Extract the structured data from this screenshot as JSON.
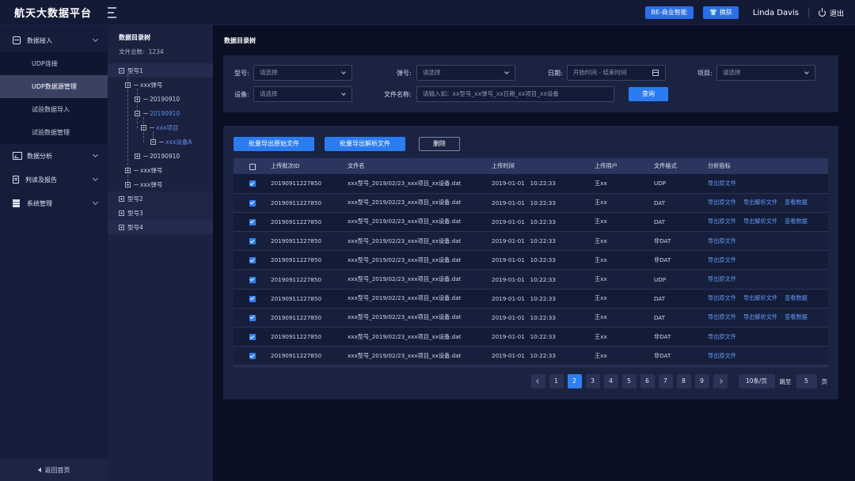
{
  "app": {
    "title": "航天大数据平台"
  },
  "topbar": {
    "btn_be": "BE-商业智能",
    "btn_skin": "换肤",
    "user": "Linda Davis",
    "logout": "退出"
  },
  "sidebar": {
    "groups": [
      {
        "label": "数据接入",
        "icon": "database-icon"
      },
      {
        "label": "数据分析",
        "icon": "chart-icon"
      },
      {
        "label": "判读及报告",
        "icon": "document-icon"
      },
      {
        "label": "系统管理",
        "icon": "stack-icon"
      }
    ],
    "subs": [
      "UDP连接",
      "UDP数据源管理",
      "试验数据导入",
      "试验数据管理"
    ],
    "back_home": "返回首页"
  },
  "tree": {
    "title": "数据目录树",
    "count_label": "文件总数:",
    "count": "1234",
    "nodes": [
      "型号1",
      "xxx弹号",
      "20190910",
      "20190910",
      "xxx项目",
      "xxx设备A",
      "20190910",
      "xxx弹号",
      "xxx弹号",
      "型号2",
      "型号3",
      "型号4"
    ]
  },
  "main": {
    "page_title": "数据目录树",
    "filter": {
      "model_label": "型号:",
      "model_ph": "请选择",
      "missile_label": "弹号:",
      "missile_ph": "请选择",
      "date_label": "日期:",
      "date_ph": "开始时间 - 结束时间",
      "project_label": "项目:",
      "project_ph": "请选择",
      "device_label": "设备:",
      "device_ph": "请选择",
      "filename_label": "文件名称:",
      "filename_ph": "请输入如：xx型号_xx弹号_xx日期_xx项目_xx设备",
      "query": "查询"
    },
    "actions": {
      "export_raw": "批量导出原始文件",
      "export_parsed": "批量导出解析文件",
      "delete": "删除"
    },
    "table": {
      "headers": [
        "上传批次ID",
        "文件名",
        "上传时间",
        "上传用户",
        "文件格式",
        "分析指标"
      ],
      "rows": [
        {
          "id": "20190911227850",
          "file": "xxx型号_2019/02/23_xxx项目_xx设备.dat",
          "time": "2019-01-01   10:22:33",
          "user": "王xx",
          "fmt": "UDP",
          "acts": [
            "导出原文件"
          ]
        },
        {
          "id": "20190911227850",
          "file": "xxx型号_2019/02/23_xxx项目_xx设备.dat",
          "time": "2019-01-01   10:22:33",
          "user": "王xx",
          "fmt": "DAT",
          "acts": [
            "导出原文件",
            "导出解析文件",
            "查看数据"
          ]
        },
        {
          "id": "20190911227850",
          "file": "xxx型号_2019/02/23_xxx项目_xx设备.dat",
          "time": "2019-01-01   10:22:33",
          "user": "王xx",
          "fmt": "DAT",
          "acts": [
            "导出原文件",
            "导出解析文件",
            "查看数据"
          ]
        },
        {
          "id": "20190911227850",
          "file": "xxx型号_2019/02/23_xxx项目_xx设备.dat",
          "time": "2019-01-01   10:22:33",
          "user": "王xx",
          "fmt": "非DAT",
          "acts": [
            "导出原文件"
          ]
        },
        {
          "id": "20190911227850",
          "file": "xxx型号_2019/02/23_xxx项目_xx设备.dat",
          "time": "2019-01-01   10:22:33",
          "user": "王xx",
          "fmt": "非DAT",
          "acts": [
            "导出原文件"
          ]
        },
        {
          "id": "20190911227850",
          "file": "xxx型号_2019/02/23_xxx项目_xx设备.dat",
          "time": "2019-01-01   10:22:33",
          "user": "王xx",
          "fmt": "UDP",
          "acts": [
            "导出原文件"
          ]
        },
        {
          "id": "20190911227850",
          "file": "xxx型号_2019/02/23_xxx项目_xx设备.dat",
          "time": "2019-01-01   10:22:33",
          "user": "王xx",
          "fmt": "DAT",
          "acts": [
            "导出原文件",
            "导出解析文件",
            "查看数据"
          ]
        },
        {
          "id": "20190911227850",
          "file": "xxx型号_2019/02/23_xxx项目_xx设备.dat",
          "time": "2019-01-01   10:22:33",
          "user": "王xx",
          "fmt": "DAT",
          "acts": [
            "导出原文件",
            "导出解析文件",
            "查看数据"
          ]
        },
        {
          "id": "20190911227850",
          "file": "xxx型号_2019/02/23_xxx项目_xx设备.dat",
          "time": "2019-01-01   10:22:33",
          "user": "王xx",
          "fmt": "非DAT",
          "acts": [
            "导出原文件"
          ]
        },
        {
          "id": "20190911227850",
          "file": "xxx型号_2019/02/23_xxx项目_xx设备.dat",
          "time": "2019-01-01   10:22:33",
          "user": "王xx",
          "fmt": "非DAT",
          "acts": [
            "导出原文件"
          ]
        }
      ]
    },
    "pager": {
      "pages": [
        "1",
        "2",
        "3",
        "4",
        "5",
        "6",
        "7",
        "8",
        "9"
      ],
      "current": "2",
      "size": "10条/页",
      "jump": "跳至",
      "jump_value": "5",
      "unit": "页"
    }
  }
}
